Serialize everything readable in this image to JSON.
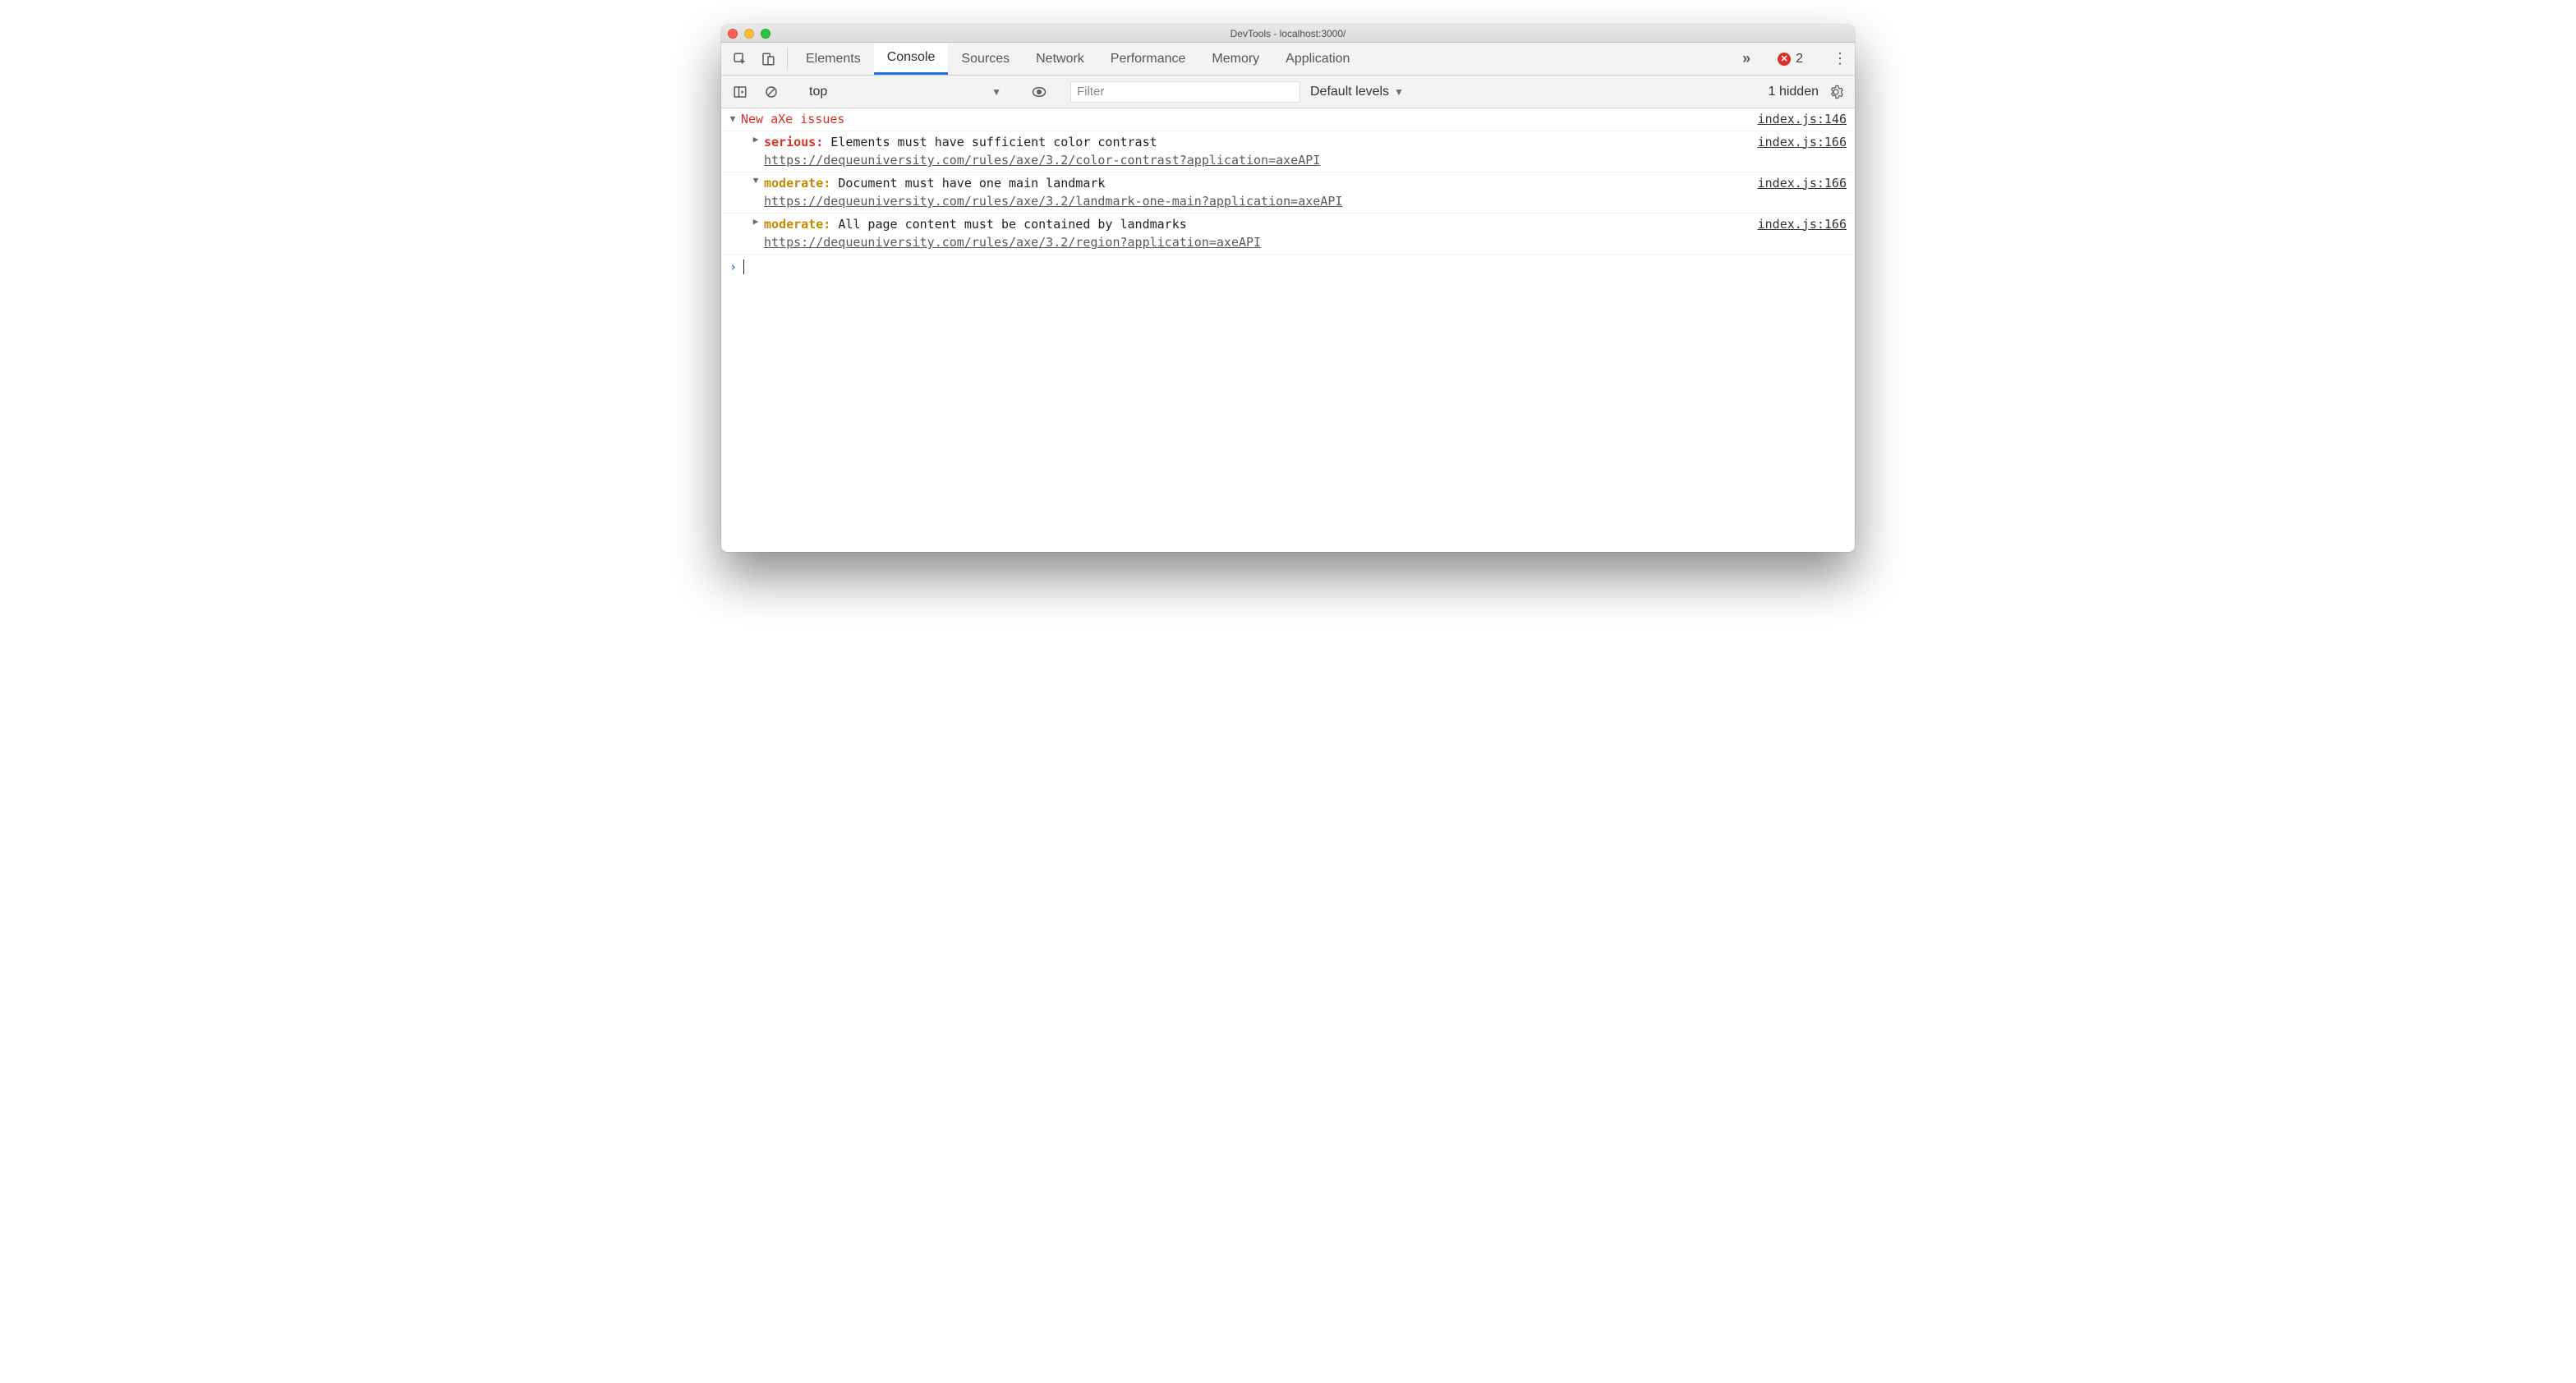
{
  "window": {
    "title": "DevTools - localhost:3000/"
  },
  "tabs": {
    "items": [
      "Elements",
      "Console",
      "Sources",
      "Network",
      "Performance",
      "Memory",
      "Application"
    ],
    "active_index": 1
  },
  "errors": {
    "count": "2"
  },
  "toolbar": {
    "context": "top",
    "filter_placeholder": "Filter",
    "levels": "Default levels",
    "hidden": "1 hidden"
  },
  "console": {
    "group_title": "New aXe issues",
    "group_src": "index.js:146",
    "issues": [
      {
        "expanded": false,
        "severity_label": "serious:",
        "severity_class": "serious",
        "msg": "Elements must have sufficient color contrast",
        "url": "https://dequeuniversity.com/rules/axe/3.2/color-contrast?application=axeAPI",
        "src": "index.js:166"
      },
      {
        "expanded": true,
        "severity_label": "moderate:",
        "severity_class": "moderate",
        "msg": "Document must have one main landmark",
        "url": "https://dequeuniversity.com/rules/axe/3.2/landmark-one-main?application=axeAPI",
        "src": "index.js:166"
      },
      {
        "expanded": false,
        "severity_label": "moderate:",
        "severity_class": "moderate",
        "msg": "All page content must be contained by landmarks",
        "url": "https://dequeuniversity.com/rules/axe/3.2/region?application=axeAPI",
        "src": "index.js:166"
      }
    ]
  }
}
